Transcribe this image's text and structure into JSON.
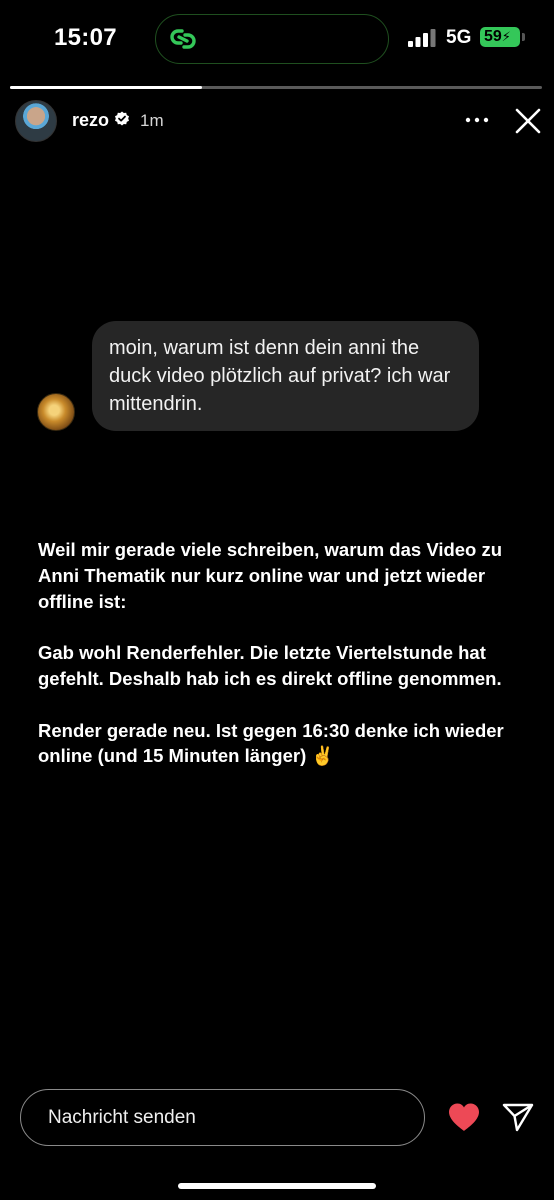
{
  "status_bar": {
    "time": "15:07",
    "network": "5G",
    "battery": "59",
    "island_icon": "link-icon",
    "accent": "#34c759"
  },
  "story": {
    "progress": 0.36,
    "username": "rezo",
    "verified": true,
    "time_ago": "1m",
    "quoted_message": "moin, warum ist denn dein anni the duck video plötzlich auf privat? ich war mittendrin.",
    "paragraphs": [
      "Weil mir gerade viele schreiben, warum das Video zu Anni Thematik nur kurz online war und jetzt wieder offline ist:",
      "Gab wohl Renderfehler. Die letzte Viertelstunde hat gefehlt. Deshalb hab ich es direkt offline genommen.",
      "Render gerade neu. Ist gegen 16:30 denke ich wieder online (und 15 Minuten länger) ✌️"
    ]
  },
  "reply": {
    "placeholder": "Nachricht senden",
    "heart_color": "#ed4956"
  }
}
